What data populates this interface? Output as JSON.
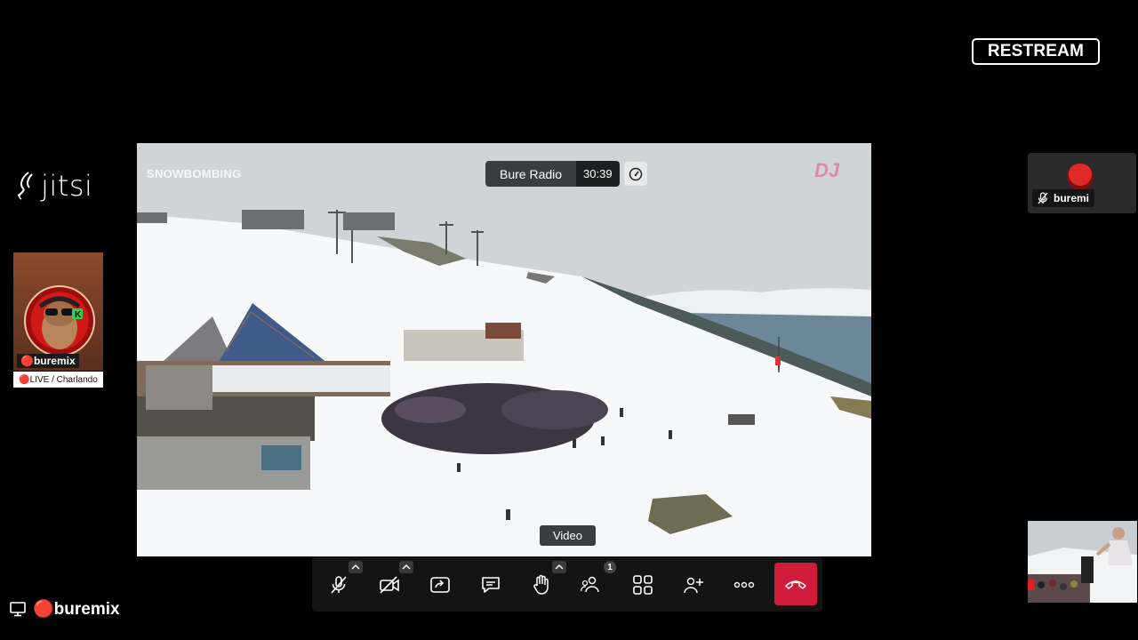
{
  "branding": {
    "restream_logo": "RESTREAM",
    "jitsi_logo": "jitsi"
  },
  "conference": {
    "name": "Bure Radio",
    "timer": "30:39"
  },
  "main_video": {
    "overlay_left": "SNOWBOMBING",
    "overlay_right": "DJ",
    "label": "Video"
  },
  "participants": {
    "left_tile": {
      "name": "🔴buremix",
      "status": "🔴LIVE / Charlando"
    },
    "right_tile": {
      "name": "buremi",
      "mic_state": "muted"
    },
    "local": {
      "name": "🔴buremix"
    }
  },
  "toolbar": {
    "buttons": [
      "microphone-muted",
      "camera-off",
      "share-screen",
      "chat",
      "raise-hand",
      "participants",
      "tile-view",
      "invite",
      "more",
      "hangup"
    ],
    "participant_count": "1",
    "hangup_color": "#d11b3b"
  }
}
